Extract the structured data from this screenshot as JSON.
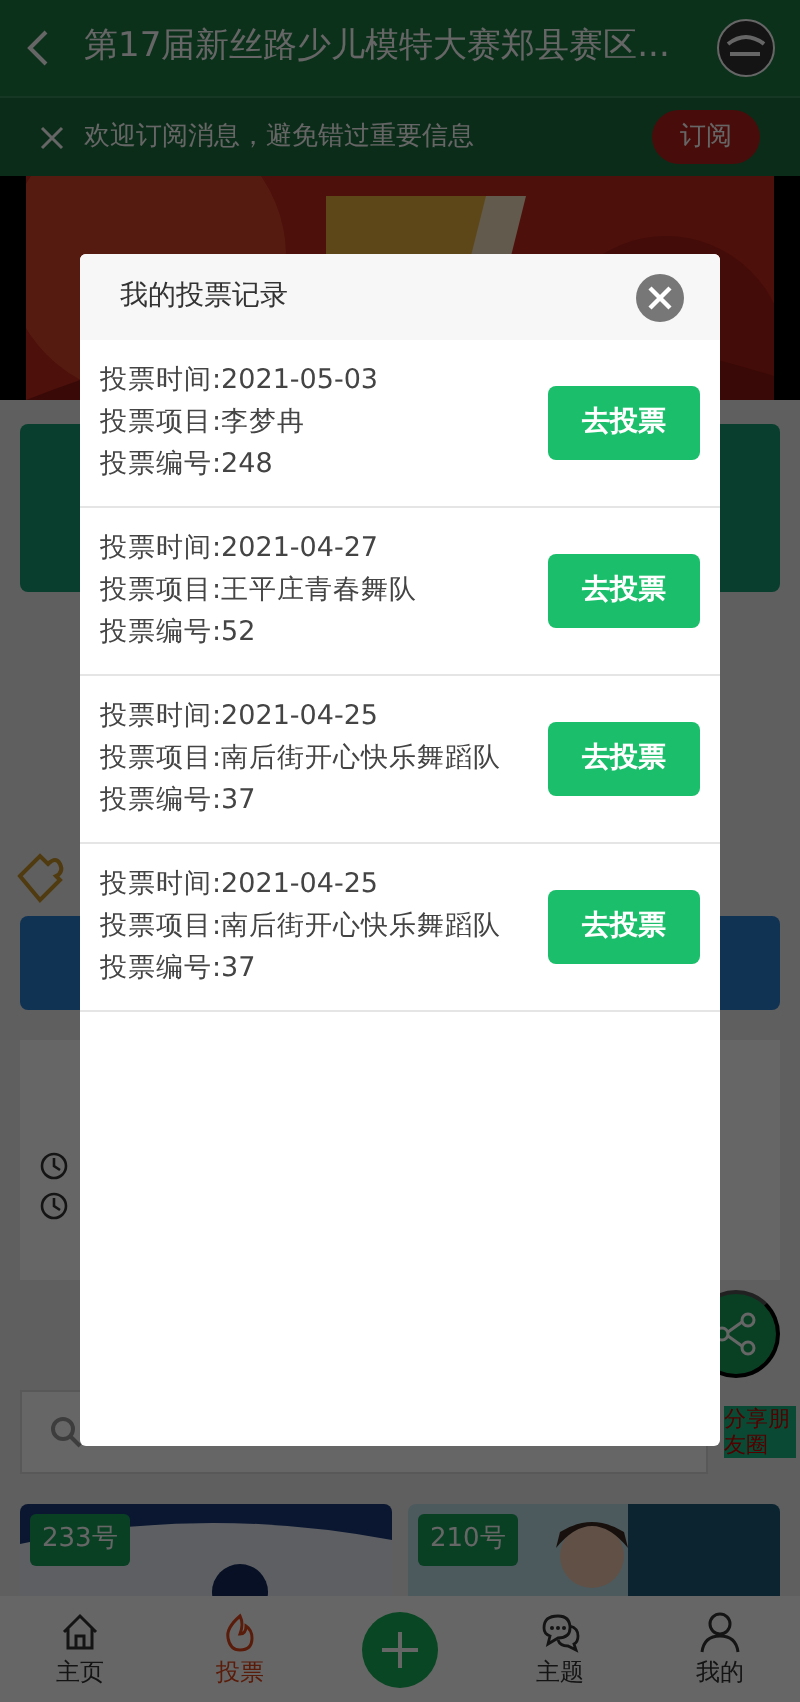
{
  "header": {
    "title": "第17届新丝路少儿模特大赛郑县赛区..."
  },
  "subscribe_bar": {
    "text": "欢迎订阅消息，避免错过重要信息",
    "button": "订阅"
  },
  "share": {
    "label": "分享朋友圈"
  },
  "entries": [
    {
      "badge": "233号"
    },
    {
      "badge": "210号"
    }
  ],
  "tab_bar": [
    {
      "kind": "home",
      "label": "主页",
      "selected": false
    },
    {
      "kind": "vote",
      "label": "投票",
      "selected": true
    },
    {
      "kind": "add"
    },
    {
      "kind": "topic",
      "label": "主题",
      "selected": false
    },
    {
      "kind": "me",
      "label": "我的",
      "selected": false
    }
  ],
  "dialog": {
    "title": "我的投票记录",
    "records": [
      {
        "lines": [
          "投票时间:2021-05-03",
          "投票项目:李梦冉",
          "投票编号:248"
        ],
        "button": "去投票"
      },
      {
        "lines": [
          "投票时间:2021-04-27",
          "投票项目:王平庄青春舞队",
          "投票编号:52"
        ],
        "button": "去投票"
      },
      {
        "lines": [
          "投票时间:2021-04-25",
          "投票项目:南后街开心快乐舞蹈队",
          "投票编号:37"
        ],
        "button": "去投票"
      },
      {
        "lines": [
          "投票时间:2021-04-25",
          "投票项目:南后街开心快乐舞蹈队",
          "投票编号:37"
        ],
        "button": "去投票"
      }
    ]
  }
}
